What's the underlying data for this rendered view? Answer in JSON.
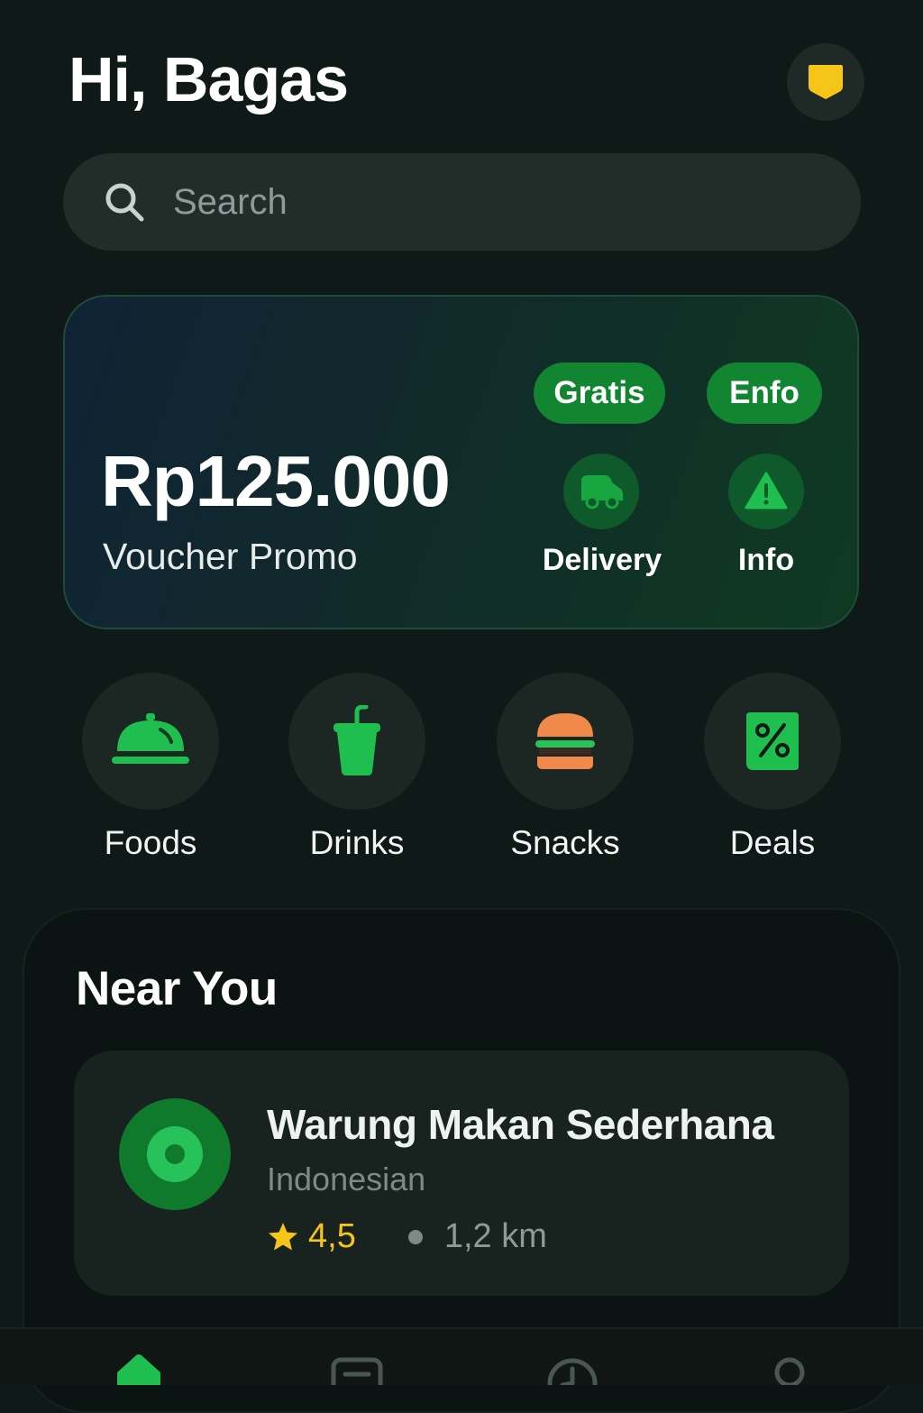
{
  "header": {
    "greeting": "Hi, Bagas"
  },
  "search": {
    "placeholder": "Search"
  },
  "promo": {
    "amount": "Rp125.000",
    "subtitle": "Voucher Promo",
    "badges": [
      "Gratis",
      "Enfo"
    ],
    "actions": [
      {
        "label": "Delivery",
        "icon": "delivery-truck-icon"
      },
      {
        "label": "Info",
        "icon": "warning-icon"
      }
    ]
  },
  "categories": [
    {
      "label": "Foods",
      "icon": "cloche-icon"
    },
    {
      "label": "Drinks",
      "icon": "drink-cup-icon"
    },
    {
      "label": "Snacks",
      "icon": "burger-icon"
    },
    {
      "label": "Deals",
      "icon": "discount-tag-icon"
    }
  ],
  "near_you": {
    "title": "Near You",
    "restaurants": [
      {
        "name": "Warung Makan Sederhana",
        "cuisine": "Indonesian",
        "rating": "4,5",
        "distance": "1,2 km"
      }
    ]
  },
  "bottom_nav": [
    {
      "icon": "home-icon",
      "active": true
    },
    {
      "icon": "orders-icon",
      "active": false
    },
    {
      "icon": "history-icon",
      "active": false
    },
    {
      "icon": "profile-icon",
      "active": false
    }
  ],
  "colors": {
    "background": "#0f1917",
    "accent": "#11852f",
    "accent_bright": "#1fbf4f",
    "rating": "#f5c518",
    "badge": "#f5c518"
  }
}
